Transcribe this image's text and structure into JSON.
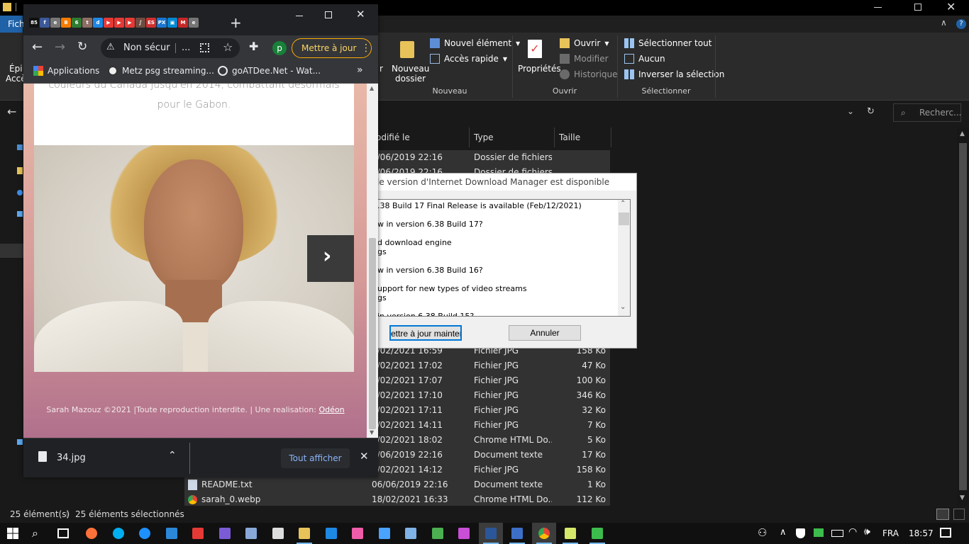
{
  "explorer": {
    "titlebar": {
      "menu_fichier": "Fich"
    },
    "ribbon": {
      "left_label_1": "Épi",
      "left_label_2": "Accè",
      "cut_label": "r",
      "nouveau_dossier": [
        "Nouveau",
        "dossier"
      ],
      "nouvel_element": "Nouvel élément",
      "acces_rapide": "Accès rapide",
      "group_nouveau": "Nouveau",
      "proprietes": "Propriétés",
      "ouvrir": "Ouvrir",
      "modifier": "Modifier",
      "historique": "Historique",
      "group_ouvrir": "Ouvrir",
      "selectionner_tout": "Sélectionner tout",
      "aucun": "Aucun",
      "inverser": "Inverser la sélection",
      "group_selectionner": "Sélectionner"
    },
    "search_placeholder": "Recherc...",
    "columns": {
      "date": "odifié le",
      "type": "Type",
      "size": "Taille"
    },
    "rows": [
      {
        "name": "",
        "date": "6/06/2019 22:16",
        "type": "Dossier de fichiers",
        "size": "",
        "sel": true
      },
      {
        "name": "",
        "date": "6/06/2019 22:16",
        "type": "Dossier de fichiers",
        "size": "",
        "sel": true
      },
      {
        "name": "",
        "date": "",
        "type": "",
        "size": "",
        "sel": true
      },
      {
        "name": "",
        "date": "",
        "type": "",
        "size": "",
        "sel": true
      },
      {
        "name": "",
        "date": "",
        "type": "",
        "size": "",
        "sel": true
      },
      {
        "name": "",
        "date": "",
        "type": "",
        "size": "",
        "sel": true
      },
      {
        "name": "",
        "date": "",
        "type": "",
        "size": "",
        "sel": true
      },
      {
        "name": "",
        "date": "",
        "type": "",
        "size": "",
        "sel": true
      },
      {
        "name": "",
        "date": "",
        "type": "",
        "size": "",
        "sel": true
      },
      {
        "name": "",
        "date": "",
        "type": "",
        "size": "",
        "sel": true
      },
      {
        "name": "",
        "date": "",
        "type": "",
        "size": "",
        "sel": true
      },
      {
        "name": "",
        "date": "",
        "type": "",
        "size": "",
        "sel": true
      },
      {
        "name": "",
        "date": "",
        "type": "",
        "size": "",
        "sel": true
      },
      {
        "name": "",
        "date": "8/02/2021 16:59",
        "type": "Fichier JPG",
        "size": "158 Ko",
        "sel": true
      },
      {
        "name": "",
        "date": "8/02/2021 17:02",
        "type": "Fichier JPG",
        "size": "47 Ko",
        "sel": true
      },
      {
        "name": "",
        "date": "8/02/2021 17:07",
        "type": "Fichier JPG",
        "size": "100 Ko",
        "sel": true
      },
      {
        "name": "",
        "date": "8/02/2021 17:10",
        "type": "Fichier JPG",
        "size": "346 Ko",
        "sel": true
      },
      {
        "name": "",
        "date": "8/02/2021 17:11",
        "type": "Fichier JPG",
        "size": "32 Ko",
        "sel": true
      },
      {
        "name": "",
        "date": "8/02/2021 14:11",
        "type": "Fichier JPG",
        "size": "7 Ko",
        "sel": true
      },
      {
        "name": "",
        "date": "8/02/2021 18:02",
        "type": "Chrome HTML Do...",
        "size": "5 Ko",
        "sel": true
      },
      {
        "name": "",
        "date": "6/06/2019 22:16",
        "type": "Document texte",
        "size": "17 Ko",
        "sel": true
      },
      {
        "name": "",
        "date": "8/02/2021 14:12",
        "type": "Fichier JPG",
        "size": "158 Ko",
        "sel": true
      },
      {
        "name": "README.txt",
        "date": "06/06/2019 22:16",
        "type": "Document texte",
        "size": "1 Ko",
        "sel": true
      },
      {
        "name": "sarah_0.webp",
        "date": "18/02/2021 16:33",
        "type": "Chrome HTML Do...",
        "size": "112 Ko",
        "sel": true
      }
    ],
    "status": {
      "count": "25 élément(s)",
      "selected": "25 éléments sélectionnés"
    }
  },
  "idm": {
    "title": "le version d'Internet Download Manager est disponible",
    "lines": [
      ".38 Build 17 Final Release is available (Feb/12/2021)",
      "w in version 6.38 Build 17?",
      "d download engine",
      "gs",
      "w in version 6.38 Build 16?",
      "upport for new types of video streams",
      "gs",
      "in version 6.38 Build 15?"
    ],
    "btn_update": "ettre à jour maintena",
    "btn_cancel": "Annuler"
  },
  "chrome": {
    "toolbar": {
      "security_label": "Non sécur",
      "ellipsis": "...",
      "update_label": "Mettre à jour",
      "profile_letter": "p"
    },
    "bookmarks": [
      {
        "label": "Applications"
      },
      {
        "label": "Metz psg streaming..."
      },
      {
        "label": "goATDee.Net - Wat..."
      }
    ],
    "page": {
      "text_line_1": "couleurs du Canada jusqu'en 2014, combattant désormais",
      "text_line_2": "pour le Gabon.",
      "footer_text": "Sarah Mazouz ©2021 |Toute reproduction interdite.  |  Une realisation: ",
      "footer_link": "Odéon"
    },
    "downloads": {
      "file": "34.jpg",
      "show_all": "Tout afficher"
    }
  },
  "taskbar": {
    "lang": "FRA",
    "time": "18:57"
  },
  "colors": {
    "accent": "#76b9ed",
    "chrome_update": "#fdd663",
    "page_gradient_top": "#e8b8a8",
    "page_gradient_bottom": "#b0708c"
  }
}
